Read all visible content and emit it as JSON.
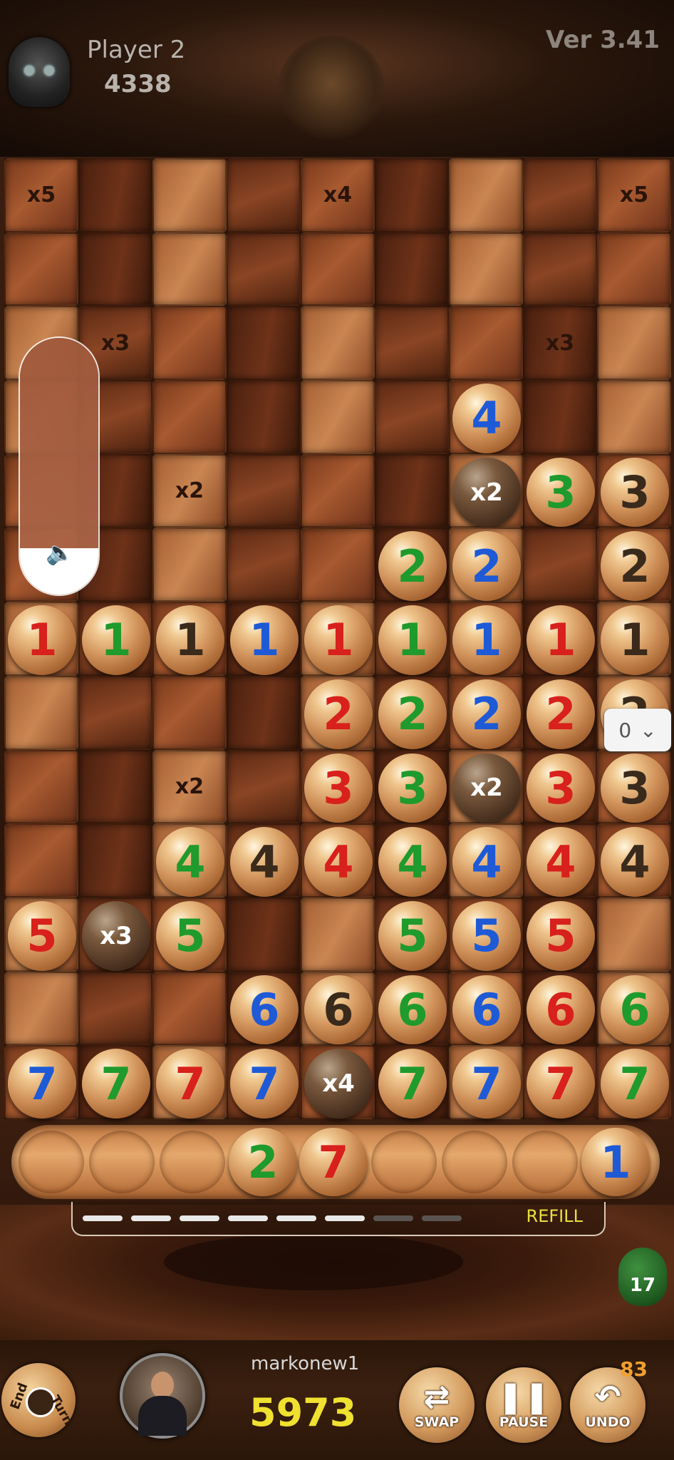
{
  "header": {
    "player_name": "Player 2",
    "player_score": "4338",
    "version": "Ver 3.41"
  },
  "colors": {
    "red": "#d8201c",
    "green": "#1f9a2c",
    "blue": "#1e5ad6",
    "black": "#3a2a1c"
  },
  "board": {
    "rows": 13,
    "cols": 9,
    "multipliers": [
      {
        "row": 0,
        "col": 0,
        "label": "x5"
      },
      {
        "row": 0,
        "col": 4,
        "label": "x4"
      },
      {
        "row": 0,
        "col": 8,
        "label": "x5"
      },
      {
        "row": 2,
        "col": 1,
        "label": "x3"
      },
      {
        "row": 2,
        "col": 7,
        "label": "x3"
      },
      {
        "row": 4,
        "col": 2,
        "label": "x2"
      },
      {
        "row": 8,
        "col": 2,
        "label": "x2"
      }
    ],
    "tiles": [
      {
        "row": 3,
        "col": 6,
        "value": "4",
        "color": "blue"
      },
      {
        "row": 4,
        "col": 6,
        "value": "x2",
        "color": "dark"
      },
      {
        "row": 4,
        "col": 7,
        "value": "3",
        "color": "green"
      },
      {
        "row": 4,
        "col": 8,
        "value": "3",
        "color": "black"
      },
      {
        "row": 5,
        "col": 5,
        "value": "2",
        "color": "green"
      },
      {
        "row": 5,
        "col": 6,
        "value": "2",
        "color": "blue"
      },
      {
        "row": 5,
        "col": 8,
        "value": "2",
        "color": "black"
      },
      {
        "row": 6,
        "col": 0,
        "value": "1",
        "color": "red"
      },
      {
        "row": 6,
        "col": 1,
        "value": "1",
        "color": "green"
      },
      {
        "row": 6,
        "col": 2,
        "value": "1",
        "color": "black"
      },
      {
        "row": 6,
        "col": 3,
        "value": "1",
        "color": "blue"
      },
      {
        "row": 6,
        "col": 4,
        "value": "1",
        "color": "red"
      },
      {
        "row": 6,
        "col": 5,
        "value": "1",
        "color": "green"
      },
      {
        "row": 6,
        "col": 6,
        "value": "1",
        "color": "blue"
      },
      {
        "row": 6,
        "col": 7,
        "value": "1",
        "color": "red"
      },
      {
        "row": 6,
        "col": 8,
        "value": "1",
        "color": "black"
      },
      {
        "row": 7,
        "col": 4,
        "value": "2",
        "color": "red"
      },
      {
        "row": 7,
        "col": 5,
        "value": "2",
        "color": "green"
      },
      {
        "row": 7,
        "col": 6,
        "value": "2",
        "color": "blue"
      },
      {
        "row": 7,
        "col": 7,
        "value": "2",
        "color": "red"
      },
      {
        "row": 7,
        "col": 8,
        "value": "2",
        "color": "black"
      },
      {
        "row": 8,
        "col": 4,
        "value": "3",
        "color": "red"
      },
      {
        "row": 8,
        "col": 5,
        "value": "3",
        "color": "green"
      },
      {
        "row": 8,
        "col": 6,
        "value": "x2",
        "color": "dark"
      },
      {
        "row": 8,
        "col": 7,
        "value": "3",
        "color": "red"
      },
      {
        "row": 8,
        "col": 8,
        "value": "3",
        "color": "black"
      },
      {
        "row": 9,
        "col": 2,
        "value": "4",
        "color": "green"
      },
      {
        "row": 9,
        "col": 3,
        "value": "4",
        "color": "black"
      },
      {
        "row": 9,
        "col": 4,
        "value": "4",
        "color": "red"
      },
      {
        "row": 9,
        "col": 5,
        "value": "4",
        "color": "green"
      },
      {
        "row": 9,
        "col": 6,
        "value": "4",
        "color": "blue"
      },
      {
        "row": 9,
        "col": 7,
        "value": "4",
        "color": "red"
      },
      {
        "row": 9,
        "col": 8,
        "value": "4",
        "color": "black"
      },
      {
        "row": 10,
        "col": 0,
        "value": "5",
        "color": "red"
      },
      {
        "row": 10,
        "col": 1,
        "value": "x3",
        "color": "dark"
      },
      {
        "row": 10,
        "col": 2,
        "value": "5",
        "color": "green"
      },
      {
        "row": 10,
        "col": 5,
        "value": "5",
        "color": "green"
      },
      {
        "row": 10,
        "col": 6,
        "value": "5",
        "color": "blue"
      },
      {
        "row": 10,
        "col": 7,
        "value": "5",
        "color": "red"
      },
      {
        "row": 11,
        "col": 3,
        "value": "6",
        "color": "blue"
      },
      {
        "row": 11,
        "col": 4,
        "value": "6",
        "color": "black"
      },
      {
        "row": 11,
        "col": 5,
        "value": "6",
        "color": "green"
      },
      {
        "row": 11,
        "col": 6,
        "value": "6",
        "color": "blue"
      },
      {
        "row": 11,
        "col": 7,
        "value": "6",
        "color": "red"
      },
      {
        "row": 11,
        "col": 8,
        "value": "6",
        "color": "green"
      },
      {
        "row": 12,
        "col": 0,
        "value": "7",
        "color": "blue"
      },
      {
        "row": 12,
        "col": 1,
        "value": "7",
        "color": "green"
      },
      {
        "row": 12,
        "col": 2,
        "value": "7",
        "color": "red"
      },
      {
        "row": 12,
        "col": 3,
        "value": "7",
        "color": "blue"
      },
      {
        "row": 12,
        "col": 4,
        "value": "x4",
        "color": "dark"
      },
      {
        "row": 12,
        "col": 5,
        "value": "7",
        "color": "green"
      },
      {
        "row": 12,
        "col": 6,
        "value": "7",
        "color": "blue"
      },
      {
        "row": 12,
        "col": 7,
        "value": "7",
        "color": "red"
      },
      {
        "row": 12,
        "col": 8,
        "value": "7",
        "color": "green"
      }
    ]
  },
  "volume": {
    "level": 0.18,
    "icon": "speaker-icon"
  },
  "dropdown": {
    "value": "0"
  },
  "rack": {
    "slots": 9,
    "tiles": [
      {
        "slot": 3,
        "value": "2",
        "color": "green"
      },
      {
        "slot": 4,
        "value": "7",
        "color": "red"
      },
      {
        "slot": 8,
        "value": "1",
        "color": "blue"
      }
    ]
  },
  "bag": {
    "refill_label": "REFILL",
    "segments": 10,
    "filled": 6,
    "count": "17"
  },
  "footer": {
    "end_label": "End",
    "turn_label": "Turn",
    "user_name": "markonew1",
    "user_score": "5973",
    "swap_label": "SWAP",
    "pause_label": "PAUSE",
    "undo_label": "UNDO",
    "undo_count": "83"
  }
}
